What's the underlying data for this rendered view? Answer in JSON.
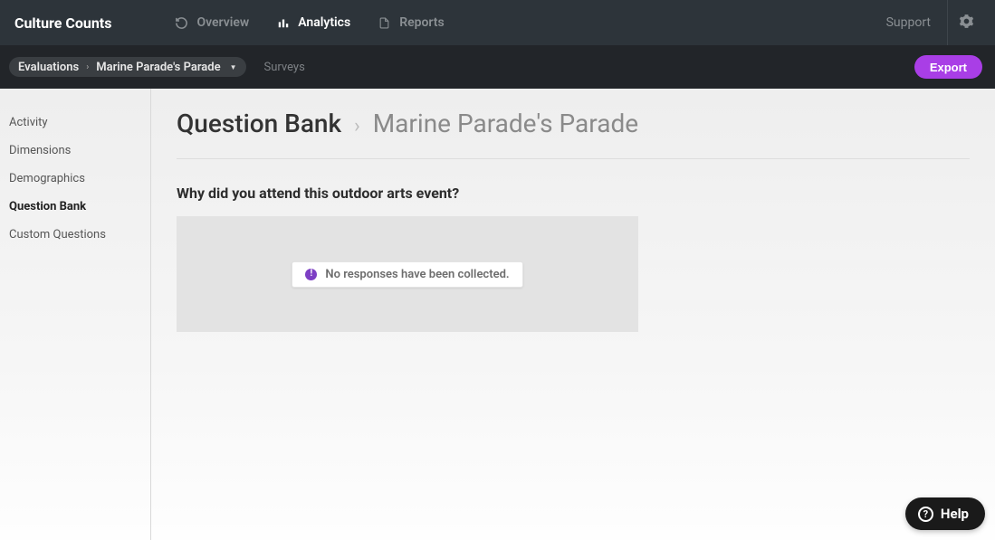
{
  "brand": "Culture Counts",
  "nav": {
    "overview": "Overview",
    "analytics": "Analytics",
    "reports": "Reports",
    "support": "Support"
  },
  "breadcrumb": {
    "root": "Evaluations",
    "current": "Marine Parade's Parade"
  },
  "subnav": {
    "surveys": "Surveys",
    "export": "Export"
  },
  "sidebar": {
    "items": [
      {
        "label": "Activity"
      },
      {
        "label": "Dimensions"
      },
      {
        "label": "Demographics"
      },
      {
        "label": "Question Bank"
      },
      {
        "label": "Custom Questions"
      }
    ],
    "activeIndex": 3
  },
  "page": {
    "title": "Question Bank",
    "subtitle": "Marine Parade's Parade"
  },
  "question": {
    "title": "Why did you attend this outdoor arts event?",
    "empty_message": "No responses have been collected."
  },
  "help": {
    "label": "Help"
  }
}
